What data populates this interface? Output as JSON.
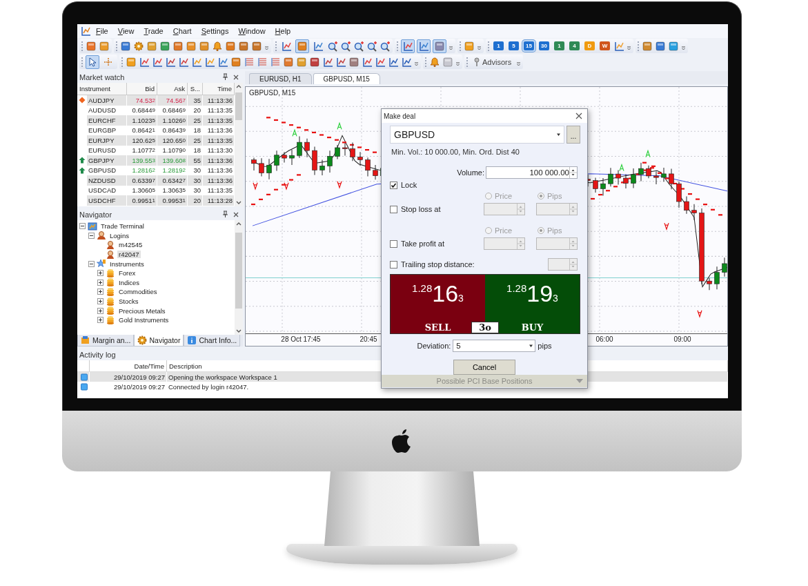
{
  "menu_bar": {
    "items": [
      "File",
      "View",
      "Trade",
      "Chart",
      "Settings",
      "Window",
      "Help"
    ]
  },
  "toolbar": {
    "chart_types": [
      {
        "selected": false
      },
      {
        "selected": true
      },
      {
        "selected": false
      }
    ],
    "chart_options": [
      {
        "on": true
      },
      {
        "on": true
      },
      {
        "on": true
      }
    ],
    "timeframes": [
      {
        "label": "1",
        "selected": false,
        "color": "#1e6fd0"
      },
      {
        "label": "5",
        "selected": false,
        "color": "#1e6fd0"
      },
      {
        "label": "15",
        "selected": true,
        "color": "#1e6fd0"
      },
      {
        "label": "30",
        "selected": false,
        "color": "#1e6fd0"
      },
      {
        "label": "1",
        "selected": false,
        "color": "#2f8a55"
      },
      {
        "label": "4",
        "selected": false,
        "color": "#2f8a55"
      },
      {
        "label": "D",
        "selected": false,
        "color": "#f09a10"
      },
      {
        "label": "W",
        "selected": false,
        "color": "#d0561c"
      }
    ],
    "cursor_tools": [
      {
        "selected": true
      },
      {
        "selected": false
      }
    ],
    "advisors_button": "Advisors"
  },
  "market_watch": {
    "title": "Market watch",
    "columns": [
      "Instrument",
      "Bid",
      "Ask",
      "S...",
      "Time"
    ],
    "rows": [
      {
        "instrument": "AUDJPY",
        "bid": "74.532",
        "ask": "74.567",
        "spread": "35",
        "time": "11:13:36",
        "kind": "down"
      },
      {
        "instrument": "AUDUSD",
        "bid": "0.68449",
        "ask": "0.68469",
        "spread": "20",
        "time": "11:13:35",
        "kind": "plain"
      },
      {
        "instrument": "EURCHF",
        "bid": "1.10235",
        "ask": "1.10260",
        "spread": "25",
        "time": "11:13:35",
        "kind": "plain"
      },
      {
        "instrument": "EURGBP",
        "bid": "0.86421",
        "ask": "0.86439",
        "spread": "18",
        "time": "11:13:36",
        "kind": "plain"
      },
      {
        "instrument": "EURJPY",
        "bid": "120.625",
        "ask": "120.650",
        "spread": "25",
        "time": "11:13:35",
        "kind": "plain"
      },
      {
        "instrument": "EURUSD",
        "bid": "1.10772",
        "ask": "1.10790",
        "spread": "18",
        "time": "11:13:30",
        "kind": "plain"
      },
      {
        "instrument": "GBPJPY",
        "bid": "139.553",
        "ask": "139.608",
        "spread": "55",
        "time": "11:13:36",
        "kind": "up"
      },
      {
        "instrument": "GBPUSD",
        "bid": "1.28162",
        "ask": "1.28192",
        "spread": "30",
        "time": "11:13:36",
        "kind": "up"
      },
      {
        "instrument": "NZDUSD",
        "bid": "0.63397",
        "ask": "0.63427",
        "spread": "30",
        "time": "11:13:36",
        "kind": "plain"
      },
      {
        "instrument": "USDCAD",
        "bid": "1.30605",
        "ask": "1.30635",
        "spread": "30",
        "time": "11:13:35",
        "kind": "plain"
      },
      {
        "instrument": "USDCHF",
        "bid": "0.99511",
        "ask": "0.99531",
        "spread": "20",
        "time": "11:13:28",
        "kind": "plain"
      }
    ]
  },
  "navigator": {
    "title": "Navigator",
    "tree": [
      {
        "label": "Trade Terminal",
        "kind": "terminal",
        "expanded": true,
        "selected": false,
        "children": [
          {
            "label": "Logins",
            "kind": "group",
            "expanded": true,
            "selected": false,
            "children": [
              {
                "label": "m42545",
                "kind": "login",
                "selected": false
              },
              {
                "label": "r42047",
                "kind": "login",
                "selected": true
              }
            ]
          },
          {
            "label": "Instruments",
            "kind": "instruments",
            "expanded": true,
            "selected": false,
            "children": [
              {
                "label": "Forex",
                "kind": "folder",
                "expanded": false,
                "selected": false
              },
              {
                "label": "Indices",
                "kind": "folder",
                "expanded": false,
                "selected": false
              },
              {
                "label": "Commodities",
                "kind": "folder",
                "expanded": false,
                "selected": false
              },
              {
                "label": "Stocks",
                "kind": "folder",
                "expanded": false,
                "selected": false
              },
              {
                "label": "Precious Metals",
                "kind": "folder",
                "expanded": false,
                "selected": false
              },
              {
                "label": "Gold Instruments",
                "kind": "folder",
                "expanded": false,
                "selected": false
              }
            ]
          }
        ]
      }
    ],
    "tabs": [
      {
        "label": "Margin an...",
        "selected": false
      },
      {
        "label": "Navigator",
        "selected": true
      },
      {
        "label": "Chart Info...",
        "selected": false
      }
    ]
  },
  "chart": {
    "tabs": [
      {
        "label": "EURUSD, H1",
        "selected": false
      },
      {
        "label": "GBPUSD, M15",
        "selected": true
      }
    ],
    "title": "GBPUSD, M15",
    "x_axis_labels": [
      "28 Oct 17:45",
      "20:45",
      "06:00",
      "09:00"
    ]
  },
  "make_deal": {
    "title": "Make deal",
    "symbol": "GBPUSD",
    "more_button": "...",
    "info": "Min. Vol.: 10 000.00, Min. Ord. Dist 40",
    "volume_label": "Volume:",
    "volume": "100 000.00",
    "options": [
      {
        "kind": "plain",
        "label": "Lock",
        "checked": true
      },
      {
        "kind": "price_pips",
        "label": "Stop loss at",
        "checked": false,
        "modes": [
          {
            "label": "Price",
            "selected": false
          },
          {
            "label": "Pips",
            "selected": true
          }
        ]
      },
      {
        "kind": "price_pips",
        "label": "Take profit at",
        "checked": false,
        "modes": [
          {
            "label": "Price",
            "selected": false
          },
          {
            "label": "Pips",
            "selected": true
          }
        ]
      },
      {
        "kind": "distance",
        "label": "Trailing stop distance:",
        "checked": false
      }
    ],
    "sell": {
      "price": "$^{1.28}$16$_{3}$",
      "label": "SELL"
    },
    "spread": "3o",
    "buy": {
      "price": "$^{1.28}$19$_{3}$",
      "label": "BUY"
    },
    "deviation_label": "Deviation:",
    "deviation": "5",
    "deviation_unit": "pips",
    "cancel_button": "Cancel",
    "footer": "Possible PCI Base Positions"
  },
  "activity_log": {
    "title": "Activity log",
    "columns": [
      "Date/Time",
      "Description"
    ],
    "rows": [
      {
        "time": "29/10/2019 09:27",
        "description": "Opening the workspace Workspace 1",
        "selected": true
      },
      {
        "time": "29/10/2019 09:27",
        "description": "Connected by login r42047.",
        "selected": false
      }
    ]
  }
}
